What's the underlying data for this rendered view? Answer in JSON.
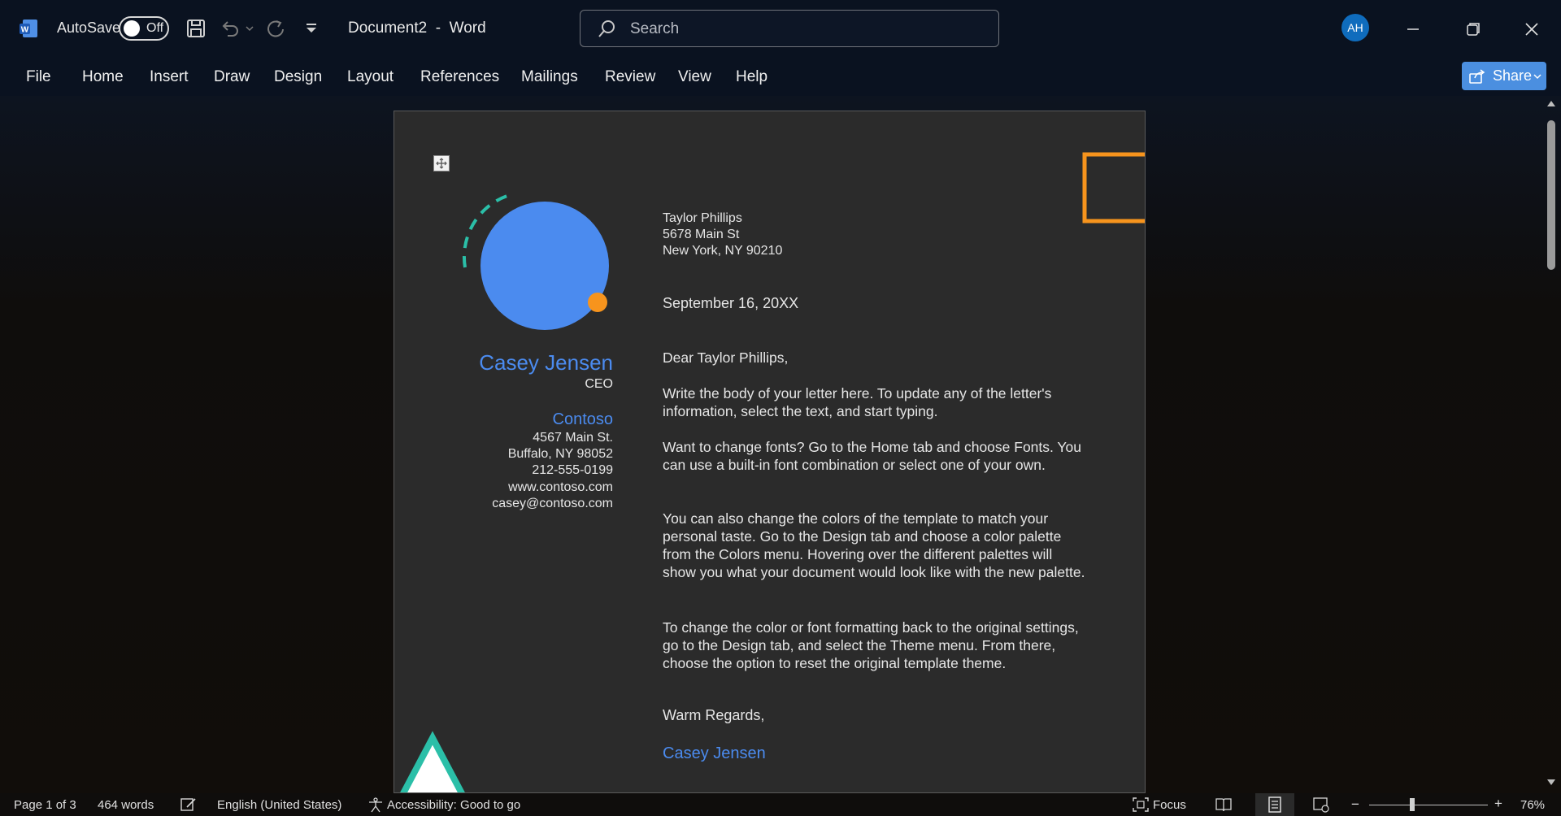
{
  "titlebar": {
    "autosave_label": "AutoSave",
    "autosave_state": "Off",
    "document_title": "Document2  -  Word",
    "search_placeholder": "Search",
    "user_initials": "AH"
  },
  "menu": {
    "items": [
      "File",
      "Home",
      "Insert",
      "Draw",
      "Design",
      "Layout",
      "References",
      "Mailings",
      "Review",
      "View",
      "Help"
    ],
    "share_label": "Share"
  },
  "letter": {
    "sender": {
      "name": "Casey Jensen",
      "title": "CEO",
      "company": "Contoso",
      "address_lines": [
        "4567 Main St.",
        "Buffalo, NY 98052",
        "212-555-0199",
        "www.contoso.com",
        "casey@contoso.com"
      ]
    },
    "recipient_lines": [
      "Taylor Phillips",
      "5678 Main St",
      "New York, NY 90210"
    ],
    "date": "September 16, 20XX",
    "salutation": "Dear Taylor Phillips,",
    "paragraphs": [
      "Write the body of your letter here. To update any of the letter's information, select the text, and start typing.",
      "Want to change fonts? Go to the Home tab and choose Fonts. You can use a built-in font combination or select one of your own.",
      "You can also change the colors of the template to match your personal taste. Go to the Design tab and choose a color palette from the Colors menu. Hovering over the different palettes will show you what your document would look like with the new palette.",
      "To change the color or font formatting back to the original settings, go to the Design tab, and select the Theme menu. From there, choose the option to reset the original template theme."
    ],
    "closing": "Warm Regards,",
    "signature": "Casey Jensen"
  },
  "statusbar": {
    "page": "Page 1 of 3",
    "words": "464 words",
    "language": "English (United States)",
    "accessibility": "Accessibility: Good to go",
    "focus": "Focus",
    "zoom_minus": "−",
    "zoom_plus": "+",
    "zoom_level": "76%"
  },
  "colors": {
    "accent_blue": "#4b8bef",
    "orange": "#f7941d",
    "teal": "#2bbfa8",
    "share_button": "#4b8fe0"
  },
  "icons": [
    "word-logo-icon",
    "save-icon",
    "undo-icon",
    "redo-icon",
    "customize-qat-icon",
    "search-icon",
    "minimize-icon",
    "restore-icon",
    "close-icon",
    "share-icon",
    "proofing-icon",
    "accessibility-icon",
    "focus-icon",
    "read-mode-icon",
    "print-layout-icon",
    "web-layout-icon"
  ]
}
